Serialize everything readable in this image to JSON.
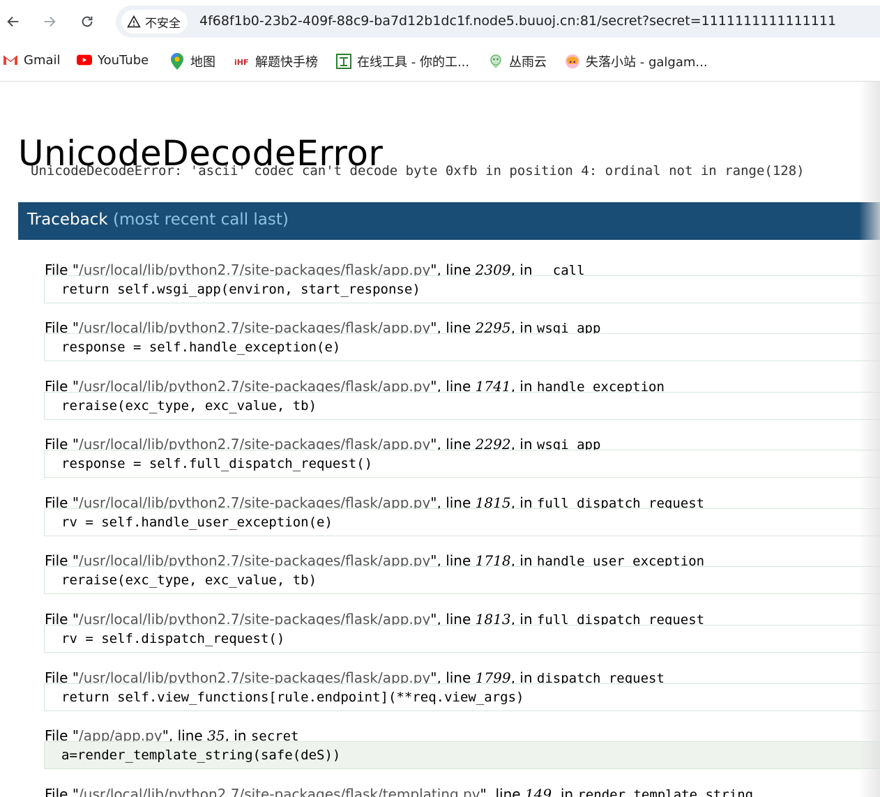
{
  "browser": {
    "security_label": "不安全",
    "url": "4f68f1b0-23b2-409f-88c9-ba7d12b1dc1f.node5.buuoj.cn:81/secret?secret=1111111111111111",
    "bookmarks": [
      {
        "label": "Gmail",
        "icon": "gmail-icon"
      },
      {
        "label": "YouTube",
        "icon": "youtube-icon"
      },
      {
        "label": "地图",
        "icon": "maps-icon"
      },
      {
        "label": "解题快手榜",
        "icon": "bookmark-icon"
      },
      {
        "label": "在线工具 - 你的工...",
        "icon": "tool-icon"
      },
      {
        "label": "丛雨云",
        "icon": "cloud-icon"
      },
      {
        "label": "失落小站 - galgam...",
        "icon": "avatar-icon"
      }
    ]
  },
  "error": {
    "title": "UnicodeDecodeError",
    "message": "UnicodeDecodeError: 'ascii' codec can't decode byte 0xfb in position 4: ordinal not in range(128)"
  },
  "traceback": {
    "header": "Traceback",
    "header_sub": "(most recent call last)",
    "frames": [
      {
        "file": "/usr/local/lib/python2.7/site-packages/flask/app.py",
        "line": "2309",
        "func": "__call__",
        "code": "return self.wsgi_app(environ, start_response)"
      },
      {
        "file": "/usr/local/lib/python2.7/site-packages/flask/app.py",
        "line": "2295",
        "func": "wsgi_app",
        "code": "response = self.handle_exception(e)"
      },
      {
        "file": "/usr/local/lib/python2.7/site-packages/flask/app.py",
        "line": "1741",
        "func": "handle_exception",
        "code": "reraise(exc_type, exc_value, tb)"
      },
      {
        "file": "/usr/local/lib/python2.7/site-packages/flask/app.py",
        "line": "2292",
        "func": "wsgi_app",
        "code": "response = self.full_dispatch_request()"
      },
      {
        "file": "/usr/local/lib/python2.7/site-packages/flask/app.py",
        "line": "1815",
        "func": "full_dispatch_request",
        "code": "rv = self.handle_user_exception(e)"
      },
      {
        "file": "/usr/local/lib/python2.7/site-packages/flask/app.py",
        "line": "1718",
        "func": "handle_user_exception",
        "code": "reraise(exc_type, exc_value, tb)"
      },
      {
        "file": "/usr/local/lib/python2.7/site-packages/flask/app.py",
        "line": "1813",
        "func": "full_dispatch_request",
        "code": "rv = self.dispatch_request()"
      },
      {
        "file": "/usr/local/lib/python2.7/site-packages/flask/app.py",
        "line": "1799",
        "func": "dispatch_request",
        "code": "return self.view_functions[rule.endpoint](**req.view_args)"
      },
      {
        "file": "/app/app.py",
        "line": "35",
        "func": "secret",
        "code": "a=render_template_string(safe(deS))"
      },
      {
        "file": "/usr/local/lib/python2.7/site-packages/flask/templating.py",
        "line": "149",
        "func": "render_template_string",
        "code": ""
      }
    ]
  }
}
